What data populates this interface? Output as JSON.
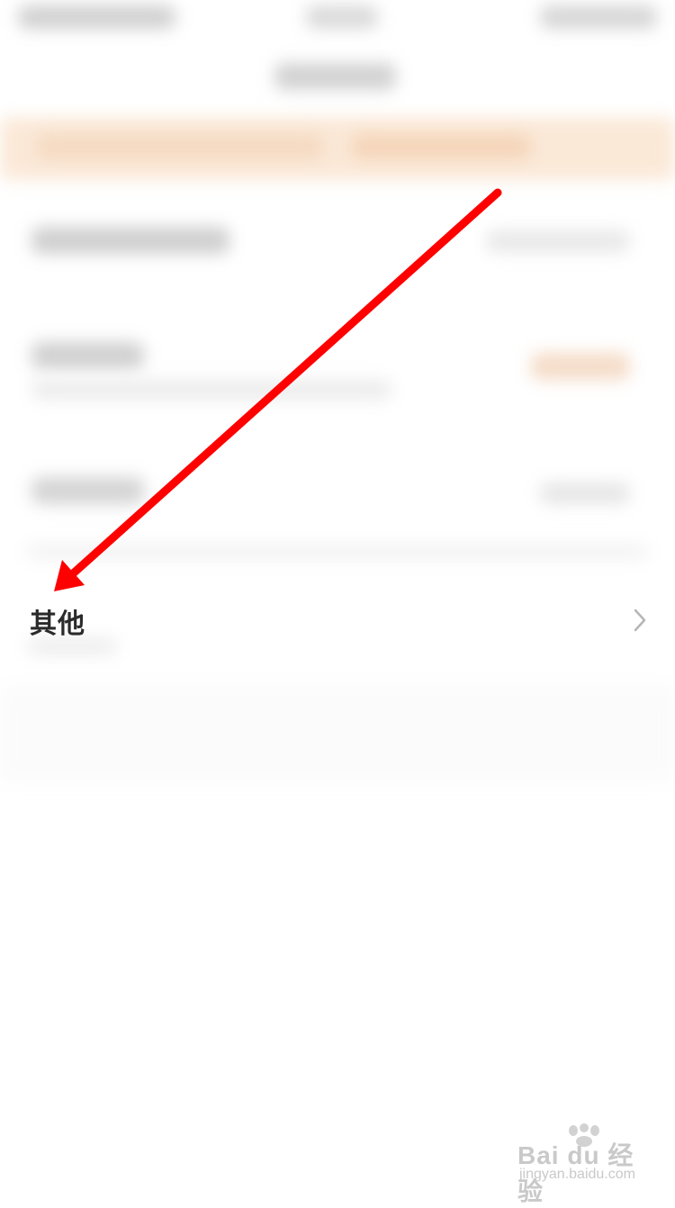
{
  "row": {
    "label": "其他",
    "chevron_icon": "chevron-right-icon"
  },
  "annotation": {
    "arrow_color": "#ff0000"
  },
  "watermark": {
    "brand": "Bai du 经验",
    "url": "jingyan.baidu.com"
  }
}
